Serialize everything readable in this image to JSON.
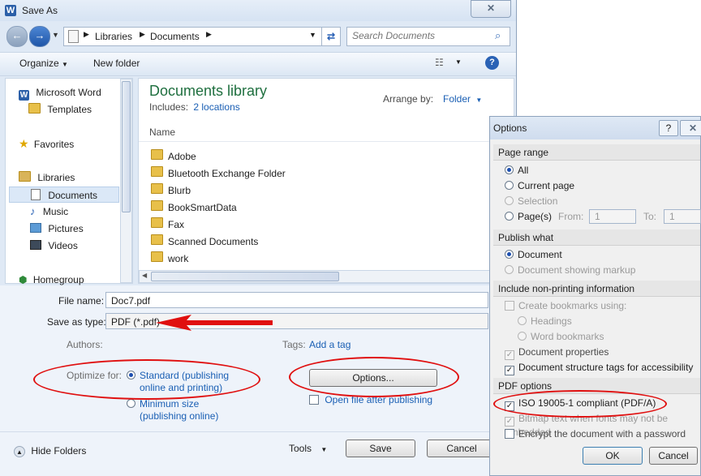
{
  "window": {
    "title": "Save As",
    "close_glyph": "✕"
  },
  "address": {
    "segments": [
      "Libraries",
      "Documents"
    ],
    "search_placeholder": "Search Documents"
  },
  "toolbar": {
    "organize": "Organize",
    "new_folder": "New folder"
  },
  "nav": {
    "items": [
      {
        "label": "Microsoft Word",
        "icon": "word-icon"
      },
      {
        "label": "Templates",
        "icon": "folder-icon"
      },
      {
        "label": "Favorites",
        "icon": "star-icon"
      },
      {
        "label": "Libraries",
        "icon": "libraries-icon"
      },
      {
        "label": "Documents",
        "icon": "documents-icon"
      },
      {
        "label": "Music",
        "icon": "music-icon"
      },
      {
        "label": "Pictures",
        "icon": "pictures-icon"
      },
      {
        "label": "Videos",
        "icon": "videos-icon"
      },
      {
        "label": "Homegroup",
        "icon": "homegroup-icon"
      }
    ],
    "hide_folders": "Hide Folders"
  },
  "library": {
    "title": "Documents library",
    "includes_label": "Includes:",
    "includes_link": "2 locations",
    "arrange_label": "Arrange by:",
    "arrange_value": "Folder",
    "column": "Name",
    "files": [
      "Adobe",
      "Bluetooth Exchange Folder",
      "Blurb",
      "BookSmartData",
      "Fax",
      "Scanned Documents",
      "work"
    ]
  },
  "form": {
    "filename_label": "File name:",
    "filename_value": "Doc7.pdf",
    "type_label": "Save as type:",
    "type_value": "PDF (*.pdf)",
    "authors_label": "Authors:",
    "tags_label": "Tags:",
    "tags_link": "Add a tag",
    "optimize_label": "Optimize for:",
    "standard": "Standard (publishing online and printing)",
    "minimum": "Minimum size (publishing online)",
    "options_button": "Options...",
    "open_after": "Open file after publishing",
    "tools": "Tools",
    "save": "Save",
    "cancel": "Cancel"
  },
  "options": {
    "title": "Options",
    "help_glyph": "?",
    "page_range": "Page range",
    "all": "All",
    "current_page": "Current page",
    "selection": "Selection",
    "pages": "Page(s)",
    "from_label": "From:",
    "from_value": "1",
    "to_label": "To:",
    "to_value": "1",
    "publish_what": "Publish what",
    "document": "Document",
    "document_markup": "Document showing markup",
    "nonprinting": "Include non-printing information",
    "create_bookmarks": "Create bookmarks using:",
    "headings": "Headings",
    "word_bookmarks": "Word bookmarks",
    "doc_properties": "Document properties",
    "structure_tags": "Document structure tags for accessibility",
    "pdf_options": "PDF options",
    "iso": "ISO 19005-1 compliant (PDF/A)",
    "bitmap": "Bitmap text when fonts may not be embedded",
    "encrypt": "Encrypt the document with a password",
    "ok": "OK",
    "cancel": "Cancel"
  },
  "colors": {
    "accent": "#1a5fb4",
    "annotation": "#e01010",
    "library_title": "#1f6f3f"
  }
}
